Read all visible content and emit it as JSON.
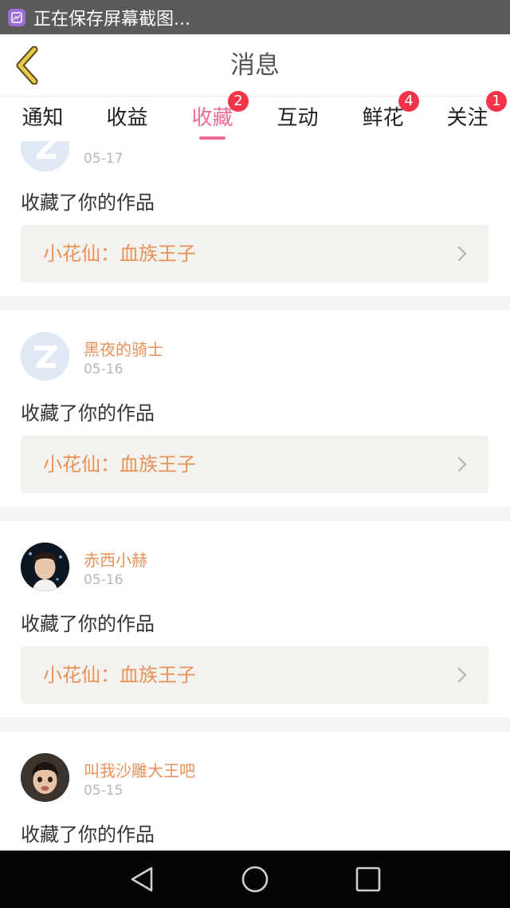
{
  "status_bar": {
    "notification": "正在保存屏幕截图..."
  },
  "header": {
    "title": "消息"
  },
  "tabs": [
    {
      "label": "通知",
      "badge": ""
    },
    {
      "label": "收益",
      "badge": ""
    },
    {
      "label": "收藏",
      "badge": "2"
    },
    {
      "label": "互动",
      "badge": ""
    },
    {
      "label": "鲜花",
      "badge": "4"
    },
    {
      "label": "关注",
      "badge": "1"
    }
  ],
  "feed": {
    "items": [
      {
        "username": "",
        "date": "05-17",
        "action": "收藏了你的作品",
        "work": "小花仙：血族王子"
      },
      {
        "username": "黑夜的骑士",
        "date": "05-16",
        "action": "收藏了你的作品",
        "work": "小花仙：血族王子"
      },
      {
        "username": "赤西小赫",
        "date": "05-16",
        "action": "收藏了你的作品",
        "work": "小花仙：血族王子"
      },
      {
        "username": "叫我沙雕大王吧",
        "date": "05-15",
        "action": "收藏了你的作品",
        "work": ""
      }
    ]
  },
  "colors": {
    "accent": "#ee6b9a",
    "badge": "#f33448",
    "name": "#e8925a",
    "back_icon": "#e6c84a"
  }
}
